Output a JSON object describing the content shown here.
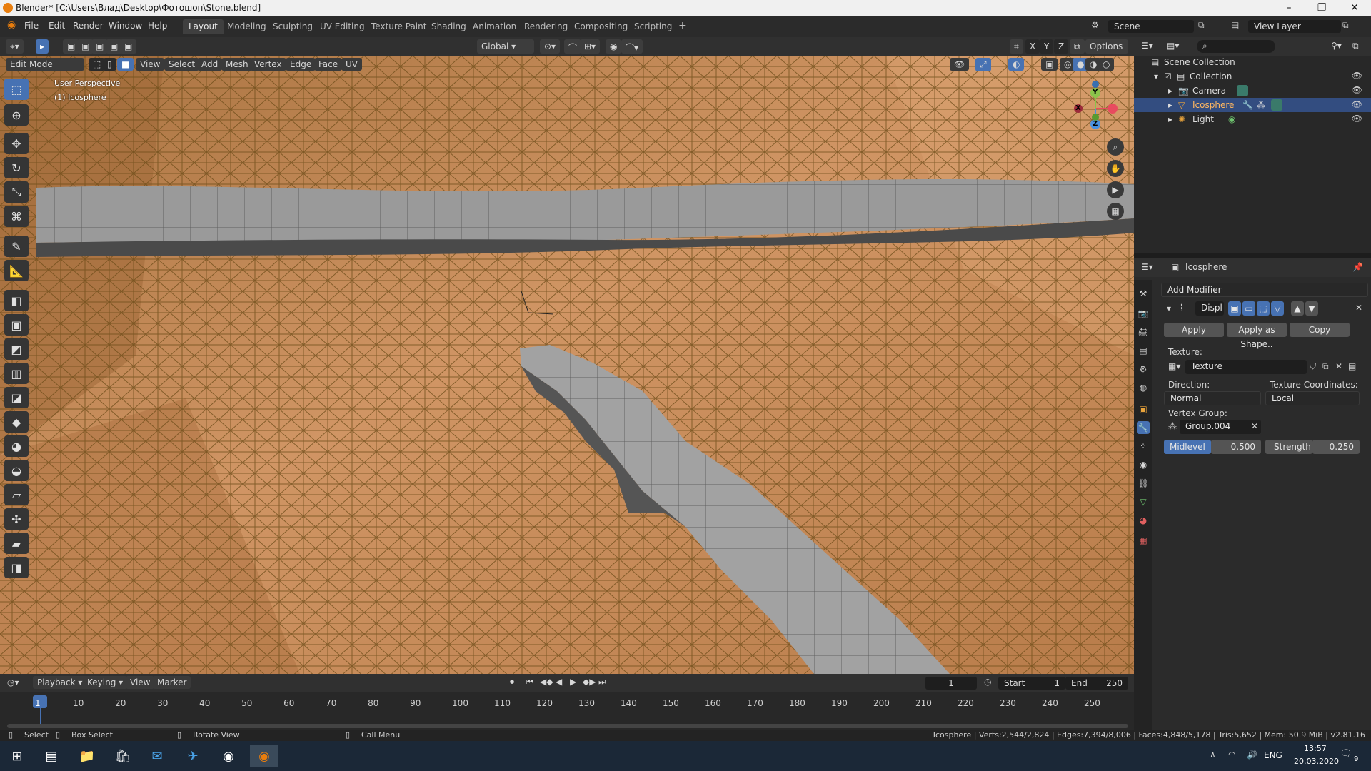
{
  "window": {
    "title": "Blender* [C:\\Users\\Влад\\Desktop\\Фотошоп\\Stone.blend]",
    "controls": [
      "–",
      "❐",
      "✕"
    ]
  },
  "menu": [
    "File",
    "Edit",
    "Render",
    "Window",
    "Help"
  ],
  "workspace_tabs": [
    {
      "label": "Layout",
      "active": true
    },
    {
      "label": "Modeling"
    },
    {
      "label": "Sculpting"
    },
    {
      "label": "UV Editing"
    },
    {
      "label": "Texture Paint"
    },
    {
      "label": "Shading"
    },
    {
      "label": "Animation"
    },
    {
      "label": "Rendering"
    },
    {
      "label": "Compositing"
    },
    {
      "label": "Scripting"
    }
  ],
  "add_workspace": "+",
  "scene": {
    "label": "Scene"
  },
  "view_layer": {
    "label": "View Layer"
  },
  "header": {
    "orientation": "Global",
    "axes": [
      "X",
      "Y",
      "Z"
    ],
    "options": "Options"
  },
  "editmode": {
    "mode": "Edit Mode",
    "menus": [
      "View",
      "Select",
      "Add",
      "Mesh",
      "Vertex",
      "Edge",
      "Face",
      "UV"
    ]
  },
  "viewport": {
    "perspective": "User Perspective",
    "object": "(1) Icosphere",
    "gizmo": {
      "x": "X",
      "y": "Y",
      "z": "Z"
    }
  },
  "outliner": {
    "root": "Scene Collection",
    "collection": "Collection",
    "items": [
      {
        "label": "Camera"
      },
      {
        "label": "Icosphere",
        "selected": true
      },
      {
        "label": "Light"
      }
    ]
  },
  "properties": {
    "object": "Icosphere",
    "add_modifier": "Add Modifier",
    "modifier_name": "Displ",
    "apply": "Apply",
    "apply_shape": "Apply as Shape..",
    "copy": "Copy",
    "texture_label": "Texture:",
    "texture_value": "Texture",
    "direction_label": "Direction:",
    "direction_value": "Normal",
    "texcoords_label": "Texture Coordinates:",
    "texcoords_value": "Local",
    "vgroup_label": "Vertex Group:",
    "vgroup_value": "Group.004",
    "midlevel_label": "Midlevel",
    "midlevel_value": "0.500",
    "strength_label": "Strength",
    "strength_value": "0.250"
  },
  "timeline": {
    "menus": [
      "Playback",
      "Keying",
      "View",
      "Marker"
    ],
    "current_frame": "1",
    "start_label": "Start",
    "start_value": "1",
    "end_label": "End",
    "end_value": "250",
    "ticks": [
      "1",
      "10",
      "20",
      "30",
      "40",
      "50",
      "60",
      "70",
      "80",
      "90",
      "100",
      "110",
      "120",
      "130",
      "140",
      "150",
      "160",
      "170",
      "180",
      "190",
      "200",
      "210",
      "220",
      "230",
      "240",
      "250"
    ]
  },
  "status": {
    "select": "Select",
    "box_select": "Box Select",
    "rotate": "Rotate View",
    "call_menu": "Call Menu",
    "stats": "Icosphere | Verts:2,544/2,824 | Edges:7,394/8,006 | Faces:4,848/5,178 | Tris:5,652 | Mem: 50.9 MiB | v2.81.16"
  },
  "taskbar": {
    "lang": "ENG",
    "time": "13:57",
    "date": "20.03.2020",
    "notifications": "9"
  },
  "colors": {
    "accent": "#4772b3",
    "blender_orange": "#e87d0d",
    "mesh_face": "#c48a58",
    "wire": "#6b4a16"
  }
}
